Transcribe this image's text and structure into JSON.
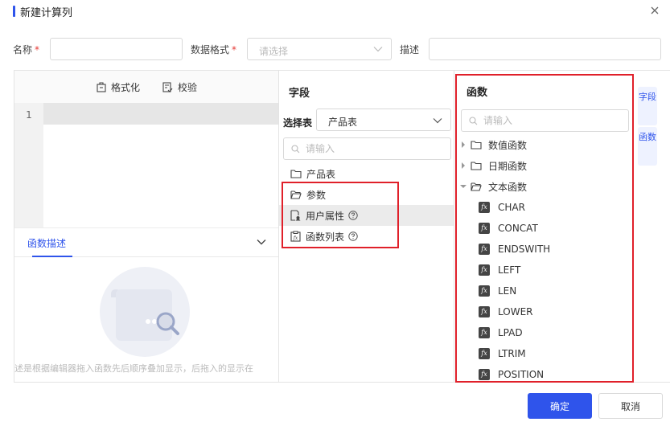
{
  "dialog": {
    "title": "新建计算列",
    "accent_color": "#2f54eb",
    "close_icon": "close-icon"
  },
  "form": {
    "name_label": "名称",
    "required_mark": "*",
    "name_value": "",
    "format_label": "数据格式",
    "format_placeholder": "请选择",
    "desc_label": "描述",
    "desc_value": ""
  },
  "editor": {
    "format_button": "格式化",
    "validate_button": "校验",
    "line_numbers": [
      "1"
    ],
    "code": "",
    "desc_tab": "函数描述",
    "empty_text": "述是根据编辑器拖入函数先后顺序叠加显示，后拖入的显示在"
  },
  "fields": {
    "title": "字段",
    "table_label": "选择表",
    "table_value": "产品表",
    "search_placeholder": "请输入",
    "items": [
      {
        "label": "产品表",
        "icon": "folder-icon"
      },
      {
        "label": "参数",
        "icon": "folder-open-icon"
      },
      {
        "label": "用户属性",
        "icon": "user-attr-icon",
        "help": true,
        "highlighted": true
      },
      {
        "label": "函数列表",
        "icon": "function-list-icon",
        "help": true
      }
    ]
  },
  "functions": {
    "title": "函数",
    "search_placeholder": "请输入",
    "groups": [
      {
        "label": "数值函数",
        "expanded": false
      },
      {
        "label": "日期函数",
        "expanded": false
      },
      {
        "label": "文本函数",
        "expanded": true
      }
    ],
    "text_functions": [
      "CHAR",
      "CONCAT",
      "ENDSWITH",
      "LEFT",
      "LEN",
      "LOWER",
      "LPAD",
      "LTRIM",
      "POSITION"
    ],
    "fx_icon": "fx-icon"
  },
  "side_tabs": [
    "字段",
    "函数"
  ],
  "footer": {
    "ok_button": "确定",
    "cancel_button": "取消"
  },
  "highlight_color": "#e0202a"
}
